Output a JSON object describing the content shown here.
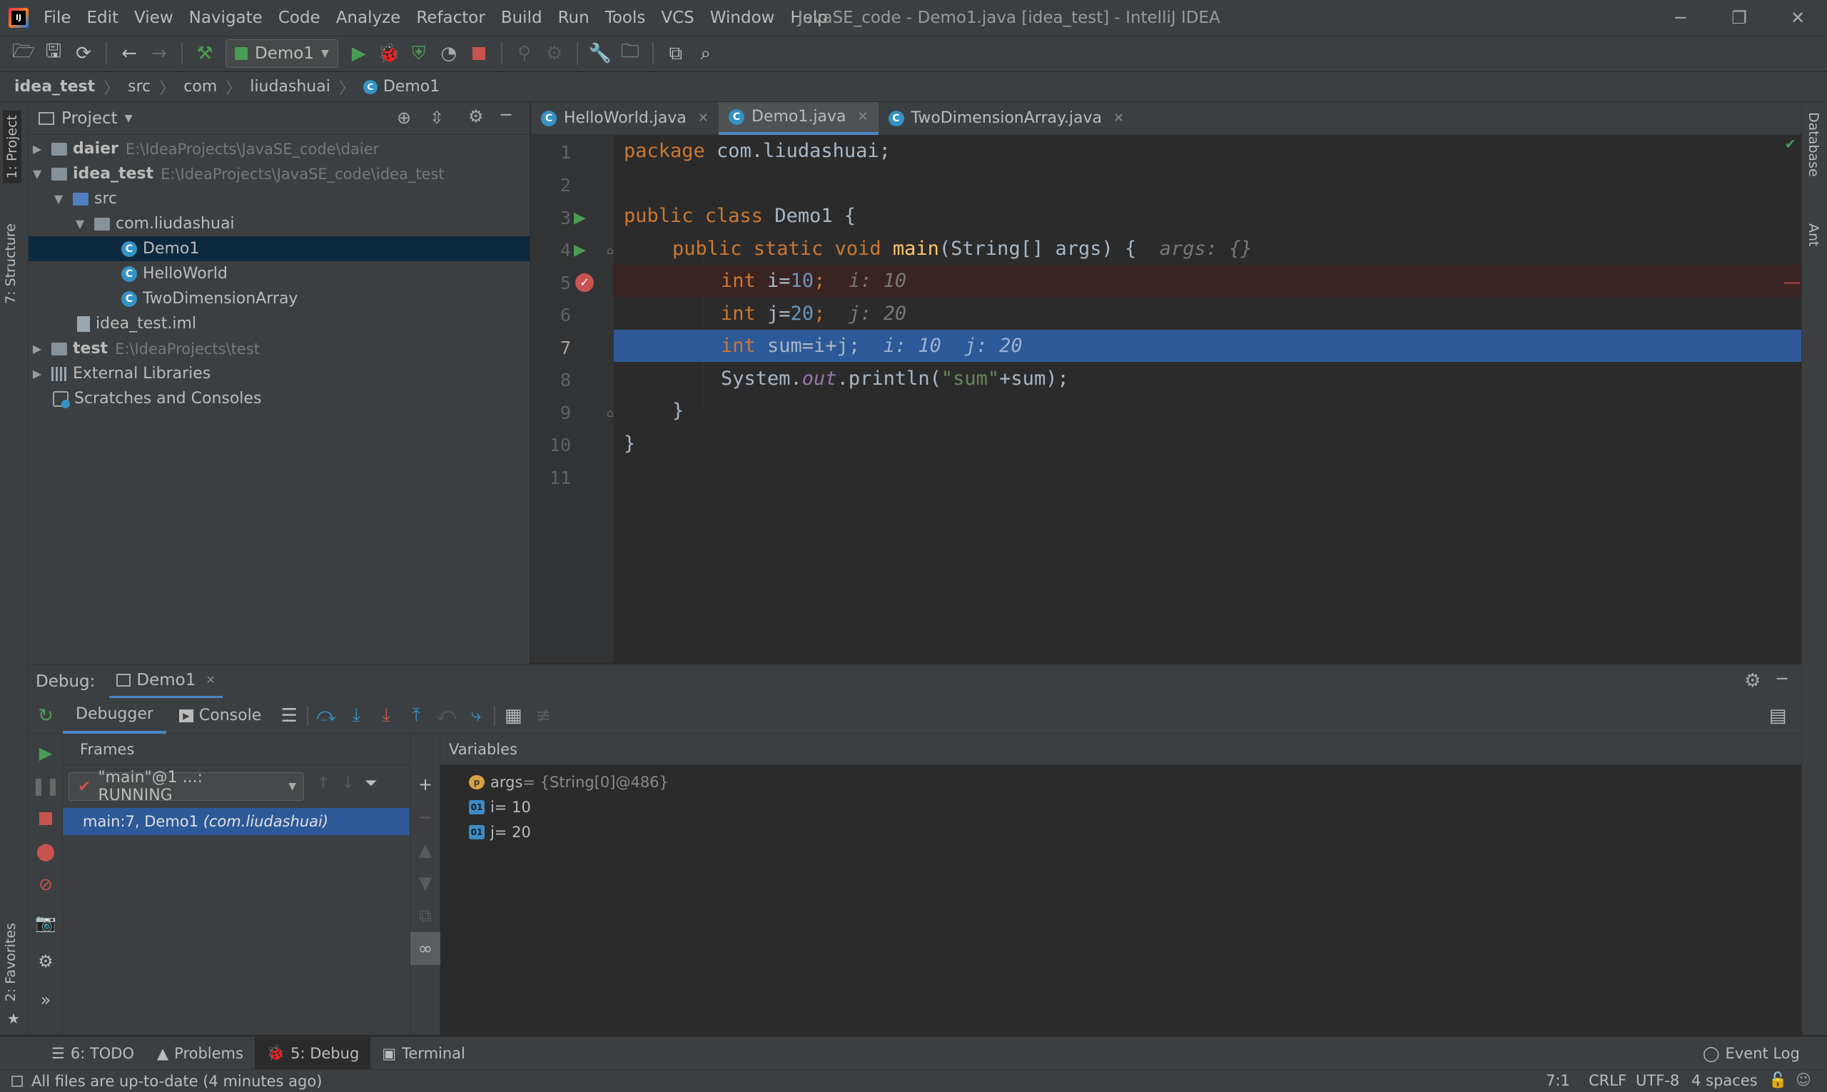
{
  "app": {
    "title": "JavaSE_code - Demo1.java [idea_test] - IntelliJ IDEA",
    "logo_letter": "IJ"
  },
  "menu": [
    "File",
    "Edit",
    "View",
    "Navigate",
    "Code",
    "Analyze",
    "Refactor",
    "Build",
    "Run",
    "Tools",
    "VCS",
    "Window",
    "Help"
  ],
  "toolbar": {
    "run_config": "Demo1"
  },
  "breadcrumb": [
    "idea_test",
    "src",
    "com",
    "liudashuai",
    "Demo1"
  ],
  "left_stripe": {
    "project_tab": "1: Project",
    "structure_tab": "7: Structure",
    "favorites_tab": "2: Favorites"
  },
  "right_stripe": {
    "database_tab": "Database",
    "ant_tab": "Ant"
  },
  "project": {
    "header": "Project",
    "tree": [
      {
        "name": "daier",
        "path": "E:\\IdeaProjects\\JavaSE_code\\daier",
        "bold": true
      },
      {
        "name": "idea_test",
        "path": "E:\\IdeaProjects\\JavaSE_code\\idea_test",
        "bold": true
      },
      {
        "name": "src"
      },
      {
        "name": "com.liudashuai"
      },
      {
        "name": "Demo1"
      },
      {
        "name": "HelloWorld"
      },
      {
        "name": "TwoDimensionArray"
      },
      {
        "name": "idea_test.iml"
      },
      {
        "name": "test",
        "path": "E:\\IdeaProjects\\test",
        "bold": true
      },
      {
        "name": "External Libraries"
      },
      {
        "name": "Scratches and Consoles"
      }
    ]
  },
  "editor": {
    "tabs": [
      "HelloWorld.java",
      "Demo1.java",
      "TwoDimensionArray.java"
    ],
    "active_tab": "Demo1.java",
    "line_numbers": [
      "1",
      "2",
      "3",
      "4",
      "5",
      "6",
      "7",
      "8",
      "9",
      "10",
      "11"
    ],
    "lines": {
      "l1_kw": "package",
      "l1_rest": " com.liudashuai;",
      "l3_kw": "public class",
      "l3_rest": " Demo1 {",
      "l4_kw": "public static void",
      "l4_fn": "main",
      "l4_rest": "(String[] args) {",
      "l4_hint": "args: {}",
      "l5_kw": "int",
      "l5_a": " i=",
      "l5_num": "10",
      "l5_semi": ";",
      "l5_hint": "i: 10",
      "l6_kw": "int",
      "l6_a": " j=",
      "l6_num": "20",
      "l6_semi": ";",
      "l6_hint": "j: 20",
      "l7_kw": "int",
      "l7_rest": " sum=i+j;",
      "l7_hint": "i: 10  j: 20",
      "l8_a": "System.",
      "l8_fld": "out",
      "l8_b": ".println(",
      "l8_str": "\"sum\"",
      "l8_c": "+sum);",
      "l9": "}",
      "l10": "}"
    },
    "current_line": 7,
    "breakpoint_line": 5
  },
  "debug": {
    "label": "Debug:",
    "session": "Demo1",
    "tabs": {
      "debugger": "Debugger",
      "console": "Console"
    },
    "frames_header": "Frames",
    "thread": "\"main\"@1 ...: RUNNING",
    "frame_main": "main:7, Demo1 ",
    "frame_pkg": "(com.liudashuai)",
    "variables_header": "Variables",
    "variables": [
      {
        "icon": "p",
        "name": "args",
        "value": " = {String[0]@486}"
      },
      {
        "icon": "01",
        "name": "i",
        "value": " = 10"
      },
      {
        "icon": "01",
        "name": "j",
        "value": " = 20"
      }
    ]
  },
  "bottom_tabs": {
    "todo": "6: TODO",
    "problems": "Problems",
    "debug": "5: Debug",
    "terminal": "Terminal",
    "event_log": "Event Log"
  },
  "status": {
    "message": "All files are up-to-date (4 minutes ago)",
    "position": "7:1",
    "line_sep": "CRLF",
    "encoding": "UTF-8",
    "indent": "4 spaces"
  },
  "colors": {
    "accent": "#4a88c7",
    "selection": "#2d5998",
    "keyword": "#cc7832",
    "number": "#6897bb",
    "string": "#6a8759",
    "run_green": "#499c54",
    "stop_red": "#c75450"
  }
}
